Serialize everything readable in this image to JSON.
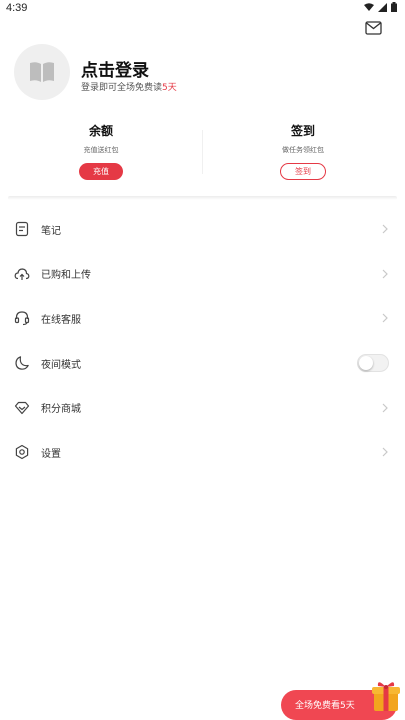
{
  "status_bar": {
    "time": "4:39",
    "icons": [
      "wifi-icon",
      "signal-icon",
      "battery-icon"
    ]
  },
  "header": {
    "mail_icon": "mail-icon",
    "avatar_icon": "book-icon",
    "title": "点击登录",
    "subtitle_prefix": "登录即可全场免费读",
    "subtitle_highlight": "5天"
  },
  "cards": {
    "balance": {
      "title": "余额",
      "subtitle": "充值送红包",
      "button": "充值"
    },
    "checkin": {
      "title": "签到",
      "subtitle": "做任务领红包",
      "button": "签到"
    }
  },
  "menu": {
    "items": [
      {
        "label": "笔记",
        "icon": "note-icon"
      },
      {
        "label": "已购和上传",
        "icon": "cloud-upload-icon"
      },
      {
        "label": "在线客服",
        "icon": "headset-icon"
      },
      {
        "label": "夜间模式",
        "icon": "moon-icon",
        "toggle_on": false
      },
      {
        "label": "积分商城",
        "icon": "diamond-icon"
      },
      {
        "label": "设置",
        "icon": "settings-icon"
      }
    ]
  },
  "promo": {
    "label": "全场免费看5天",
    "icon": "gift-box-icon"
  },
  "colors": {
    "accent": "#e53945",
    "promo": "#f04752"
  }
}
